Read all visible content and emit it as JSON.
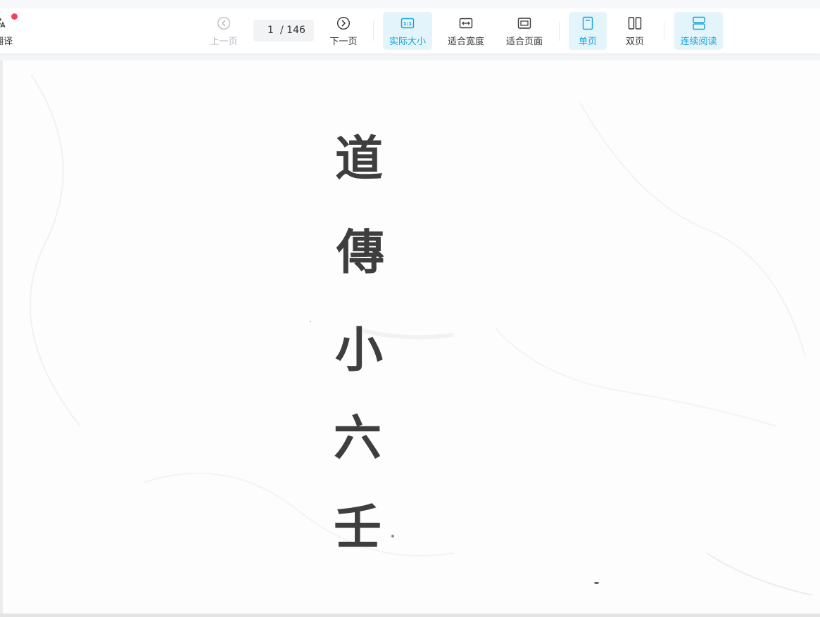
{
  "toolbar": {
    "translate_label": "翻译",
    "prev_label": "上一页",
    "next_label": "下一页",
    "current_page": "1",
    "total_pages": "/ 146",
    "actual_size_label": "实际大小",
    "actual_size_icon_text": "1:1",
    "fit_width_label": "适合宽度",
    "fit_page_label": "适合页面",
    "single_page_label": "单页",
    "double_page_label": "双页",
    "continuous_label": "连续阅读"
  },
  "document": {
    "title_chars": [
      "道",
      "傳",
      "小",
      "六",
      "壬"
    ]
  },
  "colors": {
    "accent": "#13a2d8",
    "active_bg": "#e4f4fb",
    "notification_dot": "#f43f5e",
    "disabled_text": "#b8bcc4"
  },
  "icons": {
    "translate": "translate-icon",
    "prev": "chevron-left-circle-icon",
    "next": "chevron-right-circle-icon",
    "actual_size": "actual-size-icon",
    "fit_width": "fit-width-icon",
    "fit_page": "fit-page-icon",
    "single_page": "single-page-icon",
    "double_page": "double-page-icon",
    "continuous": "continuous-read-icon"
  }
}
